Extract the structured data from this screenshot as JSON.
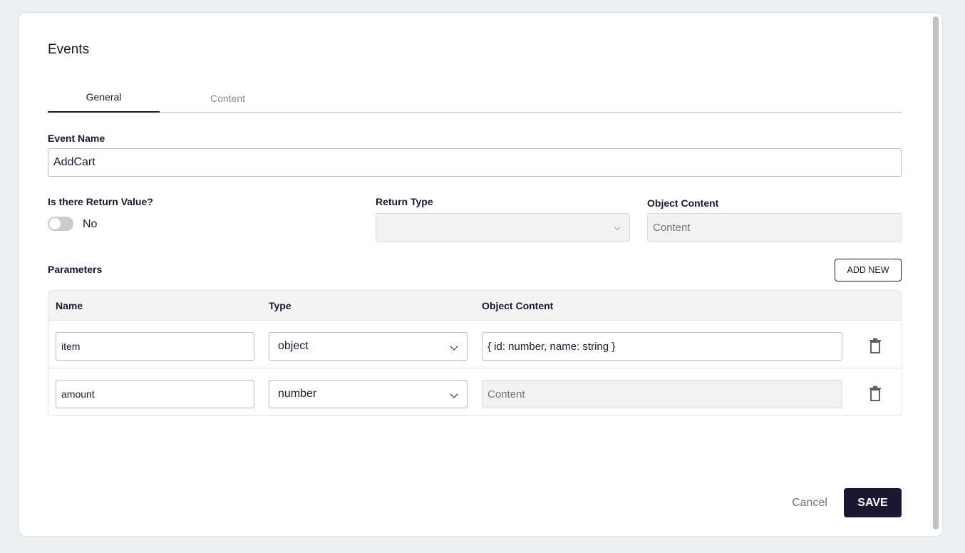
{
  "dialog": {
    "title": "Events"
  },
  "tabs": [
    {
      "label": "General",
      "active": true
    },
    {
      "label": "Content",
      "active": false
    }
  ],
  "form": {
    "event_name_label": "Event Name",
    "event_name_value": "AddCart",
    "return_value_label": "Is there Return Value?",
    "return_value_toggle": {
      "on": false,
      "text": "No"
    },
    "return_type_label": "Return Type",
    "return_type_value": "",
    "object_content_label": "Object Content",
    "object_content_placeholder": "Content"
  },
  "parameters": {
    "label": "Parameters",
    "add_new_label": "ADD NEW",
    "columns": [
      "Name",
      "Type",
      "Object Content"
    ],
    "rows": [
      {
        "name": "item",
        "type": "object",
        "object_content": "{ id: number, name: string }",
        "object_content_placeholder": "Content",
        "object_content_disabled": false
      },
      {
        "name": "amount",
        "type": "number",
        "object_content": "",
        "object_content_placeholder": "Content",
        "object_content_disabled": true
      }
    ]
  },
  "footer": {
    "cancel_label": "Cancel",
    "save_label": "SAVE"
  },
  "colors": {
    "primary": "#1b1733",
    "background": "#eceef0",
    "disabled_fill": "#f2f2f2"
  }
}
